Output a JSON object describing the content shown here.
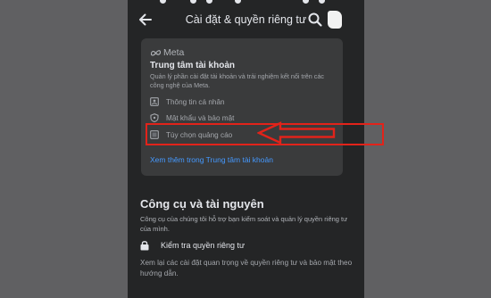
{
  "header": {
    "title": "Cài đặt & quyền riêng tư",
    "back_icon": "arrow-left-icon",
    "search_icon": "search-icon",
    "avatar_icon": "avatar-icon"
  },
  "accounts_center": {
    "brand": "Meta",
    "brand_icon": "meta-logo-icon",
    "title": "Trung tâm tài khoản",
    "description": "Quản lý phần cài đặt tài khoản và trải nghiệm kết nối trên các công nghệ của Meta.",
    "items": [
      {
        "label": "Thông tin cá nhân",
        "icon": "id-card-icon"
      },
      {
        "label": "Mật khẩu và bảo mật",
        "icon": "shield-icon"
      },
      {
        "label": "Tùy chọn quảng cáo",
        "icon": "ad-preferences-icon"
      }
    ],
    "more_link": "Xem thêm trong Trung tâm tài khoản"
  },
  "annotation": {
    "highlight_color": "#e2231a"
  },
  "tools_section": {
    "title": "Công cụ và tài nguyên",
    "description": "Công cụ của chúng tôi hỗ trợ bạn kiểm soát và quản lý quyền riêng tư của mình.",
    "privacy_check": {
      "label": "Kiểm tra quyền riêng tư",
      "icon": "lock-icon",
      "description": "Xem lại các cài đặt quan trọng về quyền riêng tư và bảo mật theo hướng dẫn."
    }
  },
  "colors": {
    "background": "#242526",
    "card": "#3a3b3c",
    "link": "#4599ff",
    "text_primary": "#e4e6eb",
    "text_secondary": "#a4a7ac"
  }
}
